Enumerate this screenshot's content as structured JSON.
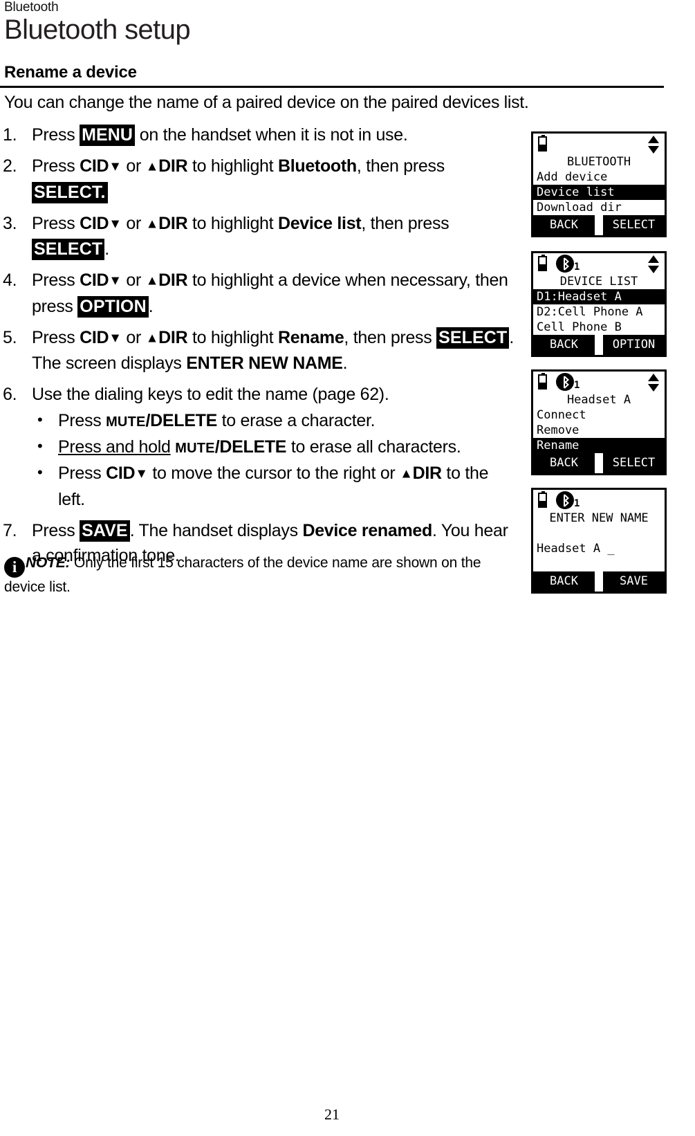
{
  "header": {
    "running_head": "Bluetooth",
    "title": "Bluetooth setup"
  },
  "section": {
    "heading": "Rename a device",
    "intro": "You can change the name of a paired device on the paired devices list."
  },
  "steps": [
    {
      "num": "1.",
      "key_press": "Press ",
      "key": "MENU",
      "rest": " on the handset when it is not in use."
    },
    {
      "num": "2.",
      "key_press": "Press ",
      "rest": ""
    },
    {
      "num": "3.",
      "key_press": "Press ",
      "rest": ""
    },
    {
      "num": "4.",
      "key_press": "Press ",
      "rest": ""
    },
    {
      "num": "5.",
      "key_press": "Press ",
      "rest": ""
    },
    {
      "num": "6.",
      "key_press": "",
      "rest": "Use the dialing keys to edit the name (page 62)."
    },
    {
      "num": "7.",
      "key_press": "Press ",
      "rest": ""
    }
  ],
  "step_text": {
    "s1_a": "Press ",
    "s1_key": "MENU",
    "s1_b": " on the handset when it is not in use.",
    "s2_a": "Press ",
    "s2_cid": "CID",
    "s2_or": " or ",
    "s2_dir": "DIR",
    "s2_b": " to highlight ",
    "s2_bold": "Bluetooth",
    "s2_c": ", then press ",
    "s2_key": "SELECT.",
    "s3_a": "Press ",
    "s3_cid": "CID",
    "s3_or": " or ",
    "s3_dir": "DIR",
    "s3_b": " to highlight ",
    "s3_bold": "Device list",
    "s3_c": ", then press ",
    "s3_key": "SELECT",
    "s3_d": ".",
    "s4_a": "Press ",
    "s4_cid": "CID",
    "s4_or": " or ",
    "s4_dir": "DIR",
    "s4_b": " to highlight a device when necessary, then press ",
    "s4_key": "OPTION",
    "s4_c": ".",
    "s5_a": "Press ",
    "s5_cid": "CID",
    "s5_or": " or ",
    "s5_dir": "DIR",
    "s5_b": " to highlight ",
    "s5_bold": "Rename",
    "s5_c": ", then press ",
    "s5_key": "SELECT",
    "s5_d": ". The screen displays ",
    "s5_bold2": "ENTER NEW NAME",
    "s5_e": ".",
    "s6_a": "Use the dialing keys to edit the name (page 62).",
    "b1_a": "Press ",
    "b1_sc": "MUTE",
    "b1_bold": "/DELETE",
    "b1_b": " to erase a character.",
    "b2_ul": "Press and hold",
    "b2_sp": " ",
    "b2_sc": "MUTE",
    "b2_bold": "/DELETE",
    "b2_b": " to erase all characters.",
    "b3_a": "Press ",
    "b3_cid": "CID",
    "b3_b": " to move the cursor to the right or ",
    "b3_dir": "DIR",
    "b3_c": " to the left.",
    "s7_a": "Press ",
    "s7_key": "SAVE",
    "s7_b": ". The handset displays ",
    "s7_bold": "Device renamed",
    "s7_c": ". You hear a confirmation tone."
  },
  "note": {
    "icon": "info-icon",
    "label": "NOTE:",
    "text": " Only the first 15 characters of the device name are shown on the device list."
  },
  "screens": [
    {
      "name": "bluetooth-menu",
      "status": {
        "battery": true,
        "bluetooth": false,
        "bt_count": "",
        "updown": true
      },
      "lines": [
        {
          "text": "BLUETOOTH",
          "center": true,
          "inverted": false
        },
        {
          "text": "Add device",
          "center": false,
          "inverted": false
        },
        {
          "text": "Device list",
          "center": false,
          "inverted": true
        },
        {
          "text": "Download dir",
          "center": false,
          "inverted": false
        }
      ],
      "softkeys": {
        "left": "BACK",
        "right": "SELECT"
      }
    },
    {
      "name": "device-list",
      "status": {
        "battery": true,
        "bluetooth": true,
        "bt_count": "1",
        "updown": true
      },
      "lines": [
        {
          "text": "DEVICE LIST",
          "center": true,
          "inverted": false
        },
        {
          "text": "D1:Headset A",
          "center": false,
          "inverted": true
        },
        {
          "text": "D2:Cell Phone A",
          "center": false,
          "inverted": false
        },
        {
          "text": "Cell Phone B",
          "center": false,
          "inverted": false
        }
      ],
      "softkeys": {
        "left": "BACK",
        "right": "OPTION"
      }
    },
    {
      "name": "device-options",
      "status": {
        "battery": true,
        "bluetooth": true,
        "bt_count": "1",
        "updown": true
      },
      "lines": [
        {
          "text": "Headset A",
          "center": true,
          "inverted": false
        },
        {
          "text": "Connect",
          "center": false,
          "inverted": false
        },
        {
          "text": "Remove",
          "center": false,
          "inverted": false
        },
        {
          "text": "Rename",
          "center": false,
          "inverted": true
        }
      ],
      "softkeys": {
        "left": "BACK",
        "right": "SELECT"
      }
    },
    {
      "name": "enter-new-name",
      "status": {
        "battery": true,
        "bluetooth": true,
        "bt_count": "1",
        "updown": false
      },
      "lines": [
        {
          "text": "ENTER NEW NAME",
          "center": true,
          "inverted": false
        },
        {
          "text": "",
          "center": false,
          "inverted": false
        },
        {
          "text": "Headset A _",
          "center": false,
          "inverted": false
        },
        {
          "text": "",
          "center": false,
          "inverted": false
        }
      ],
      "softkeys": {
        "left": "BACK",
        "right": "SAVE"
      }
    }
  ],
  "footer": {
    "page_number": "21"
  },
  "colors": {
    "ink": "#000000",
    "paper": "#ffffff",
    "title": "#231f20"
  }
}
